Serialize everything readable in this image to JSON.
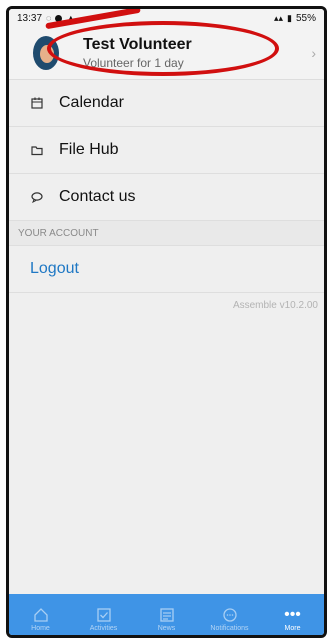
{
  "status_bar": {
    "time": "13:37",
    "battery": "55%"
  },
  "profile": {
    "name": "Test Volunteer",
    "subtitle": "Volunteer for 1 day"
  },
  "menu": [
    {
      "label": "Calendar",
      "icon": "calendar-icon"
    },
    {
      "label": "File Hub",
      "icon": "folder-icon"
    },
    {
      "label": "Contact us",
      "icon": "chat-icon"
    }
  ],
  "account": {
    "header": "YOUR ACCOUNT",
    "logout": "Logout"
  },
  "version": "Assemble v10.2.00",
  "tabs": [
    {
      "label": "Home",
      "icon": "home-icon"
    },
    {
      "label": "Activities",
      "icon": "check-icon"
    },
    {
      "label": "News",
      "icon": "news-icon"
    },
    {
      "label": "Notifications",
      "icon": "notification-icon"
    },
    {
      "label": "More",
      "icon": "more-icon"
    }
  ],
  "colors": {
    "accent": "#3f94e6",
    "link": "#1f78c4",
    "annotation": "#d10f0f"
  }
}
